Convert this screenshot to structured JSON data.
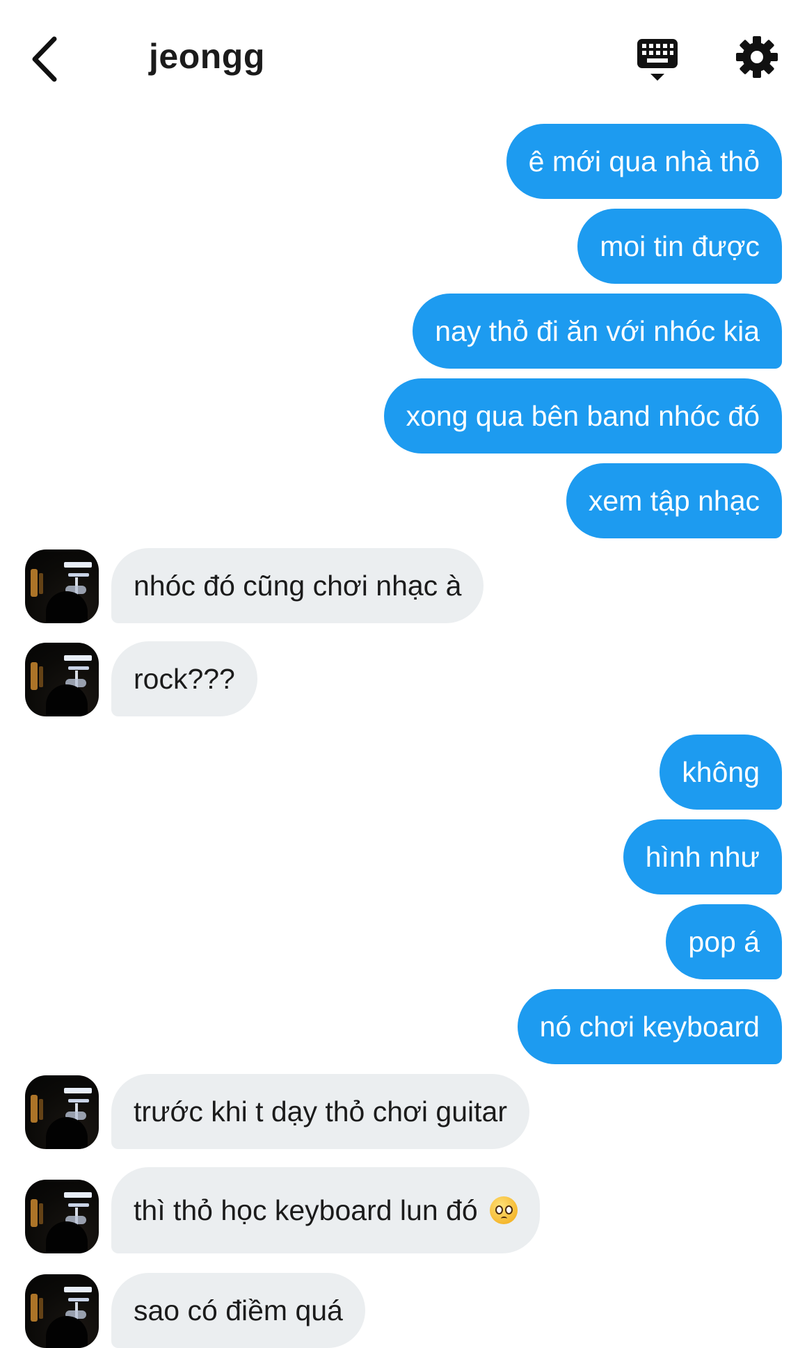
{
  "header": {
    "back_icon": "chevron-left-icon",
    "title": "jeongg",
    "keyboard_icon": "keyboard-icon",
    "settings_icon": "gear-icon"
  },
  "messages": [
    {
      "side": "sent",
      "text": "ê mới qua nhà thỏ"
    },
    {
      "side": "sent",
      "text": "moi tin được"
    },
    {
      "side": "sent",
      "text": "nay thỏ đi ăn với nhóc kia"
    },
    {
      "side": "sent",
      "text": "xong qua bên band nhóc đó"
    },
    {
      "side": "sent",
      "text": "xem tập nhạc"
    },
    {
      "side": "received",
      "text": "nhóc đó cũng chơi nhạc à"
    },
    {
      "side": "received",
      "text": "rock???"
    },
    {
      "side": "sent",
      "text": "không"
    },
    {
      "side": "sent",
      "text": "hình như"
    },
    {
      "side": "sent",
      "text": "pop á"
    },
    {
      "side": "sent",
      "text": "nó chơi keyboard"
    },
    {
      "side": "received",
      "text": "trước khi t dạy thỏ chơi guitar"
    },
    {
      "side": "received",
      "text": "thì thỏ học keyboard lun đó",
      "emoji": "pleading-face-emoji"
    },
    {
      "side": "received",
      "text": "sao có điềm quá"
    }
  ],
  "colors": {
    "sent_bubble": "#1d9bf0",
    "received_bubble": "#ebeef0",
    "background": "#ffffff"
  }
}
